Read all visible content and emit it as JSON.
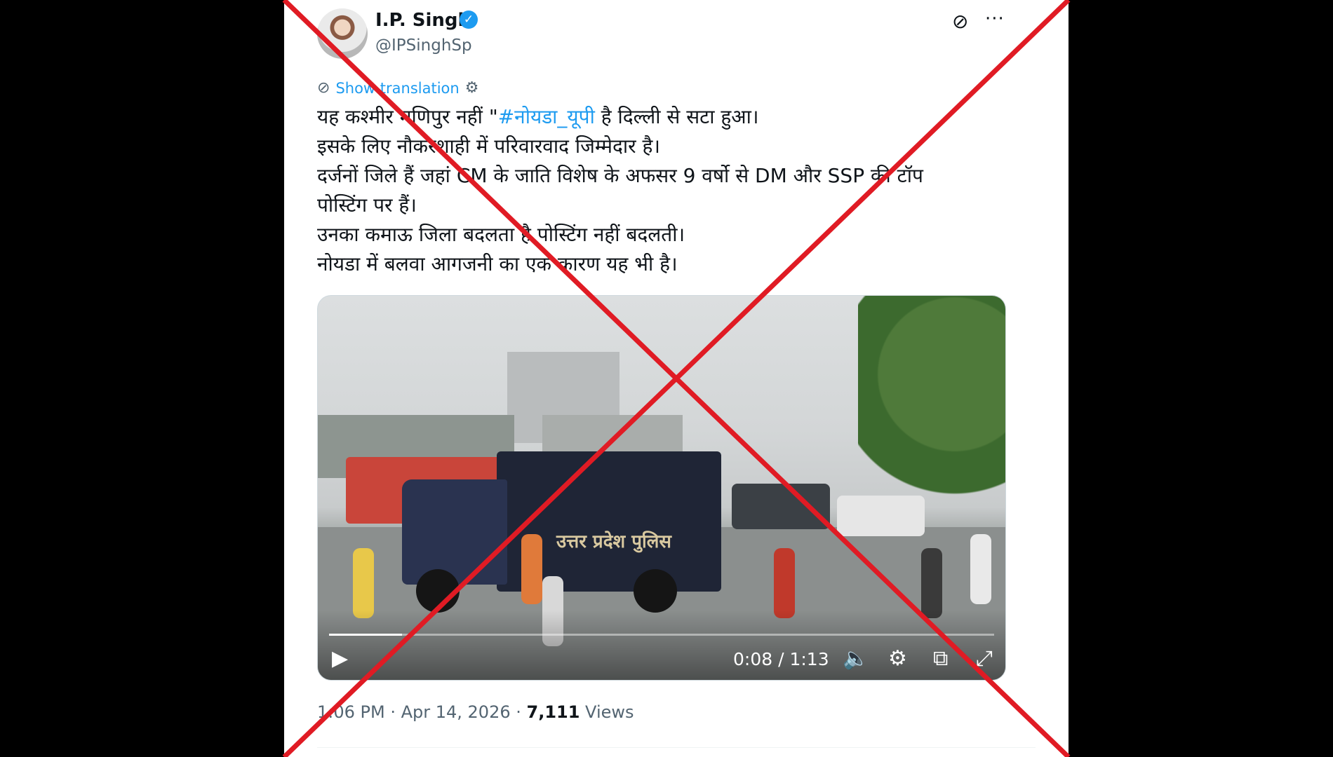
{
  "tweet": {
    "author_name": "I.P. Singh",
    "author_handle": "@IPSinghSp",
    "show_translation": "Show translation",
    "text_lines": [
      "यह कश्मीर मणिपुर नहीं \"",
      "#नोयडा_यूपी",
      " है दिल्ली से सटा हुआ।",
      "इसके लिए नौकरशाही में परिवारवाद जिम्मेदार है।",
      "दर्जनों जिले हैं जहां CM के जाति विशेष के अफसर 9 वर्षो से DM और SSP की टॉप",
      "पोस्टिंग पर हैं।",
      "उनका कमाऊ जिला बदलता है पोस्टिंग नहीं बदलती।",
      "नोयडा में बलवा आगजनी का एक कारण यह भी है।"
    ],
    "video": {
      "van_label": "उत्तर प्रदेश पुलिस",
      "time": "0:08 / 1:13",
      "progress": 0.11
    },
    "timestamp": "1:06 PM · Apr 14, 2026 · ",
    "views_count": "7,111",
    "views_label": " Views"
  },
  "icons": {
    "verified": "verified-badge-icon",
    "grok": "grok-icon",
    "more": "more-icon",
    "translate": "translate-icon",
    "settings": "gear-icon",
    "play": "play-icon",
    "volume": "volume-icon",
    "dock": "dock-icon",
    "fullscreen": "fullscreen-icon"
  },
  "colors": {
    "link_blue": "#1d9bf0",
    "cross_red": "#e01b24",
    "text_primary": "#0f1419",
    "text_secondary": "#536471"
  }
}
